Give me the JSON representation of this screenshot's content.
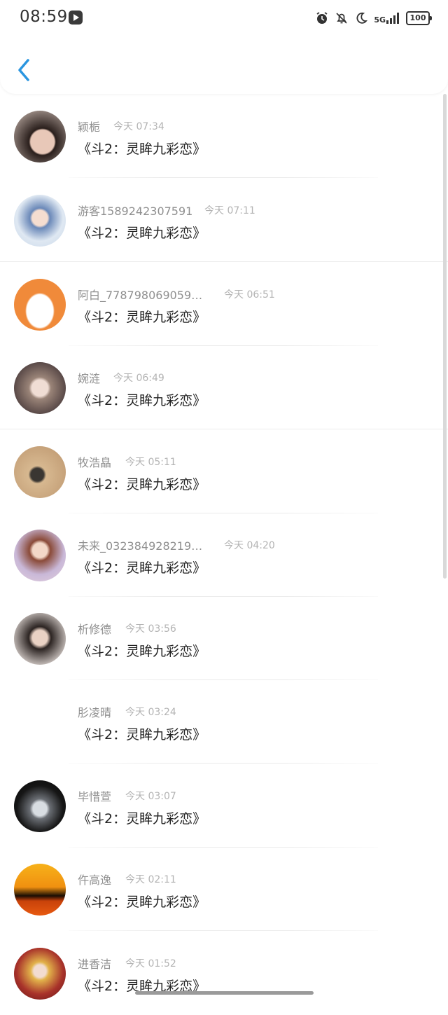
{
  "status_bar": {
    "time": "08:59",
    "network": "5G",
    "battery": "100",
    "icons": [
      "media-play-icon",
      "alarm-icon",
      "bell-off-icon",
      "moon-icon",
      "signal-icon",
      "battery-icon"
    ]
  },
  "header": {
    "back_icon": "chevron-left-icon"
  },
  "accent_color": "#2b96e0",
  "messages": [
    {
      "name": "颖栀",
      "time": "今天 07:34",
      "text": "《斗2：灵眸九彩恋》",
      "avatar": "avatar-girl-dark-hair"
    },
    {
      "name": "游客1589242307591",
      "time": "今天 07:11",
      "text": "《斗2：灵眸九彩恋》",
      "avatar": "avatar-anime-boy-hat"
    },
    {
      "name": "阿白_778798069059…",
      "time": "今天 06:51",
      "text": "《斗2：灵眸九彩恋》",
      "avatar": "avatar-cartoon-bunny"
    },
    {
      "name": "婉涟",
      "time": "今天 06:49",
      "text": "《斗2：灵眸九彩恋》",
      "avatar": "avatar-anime-girl"
    },
    {
      "name": "牧浩皛",
      "time": "今天 05:11",
      "text": "《斗2：灵眸九彩恋》",
      "avatar": "avatar-photo-toy"
    },
    {
      "name": "未来_032384928219…",
      "time": "今天 04:20",
      "text": "《斗2：灵眸九彩恋》",
      "avatar": "avatar-anime-flowers"
    },
    {
      "name": "析修德",
      "time": "今天 03:56",
      "text": "《斗2：灵眸九彩恋》",
      "avatar": "avatar-girl-photo"
    },
    {
      "name": "肜凌晴",
      "time": "今天 03:24",
      "text": "《斗2：灵眸九彩恋》",
      "avatar": ""
    },
    {
      "name": "毕惜萱",
      "time": "今天 03:07",
      "text": "《斗2：灵眸九彩恋》",
      "avatar": "avatar-crystal-trophy"
    },
    {
      "name": "仵高逸",
      "time": "今天 02:11",
      "text": "《斗2：灵眸九彩恋》",
      "avatar": "avatar-sunset-tree"
    },
    {
      "name": "进香洁",
      "time": "今天 01:52",
      "text": "《斗2：灵眸九彩恋》",
      "avatar": "avatar-anime-blonde"
    }
  ]
}
